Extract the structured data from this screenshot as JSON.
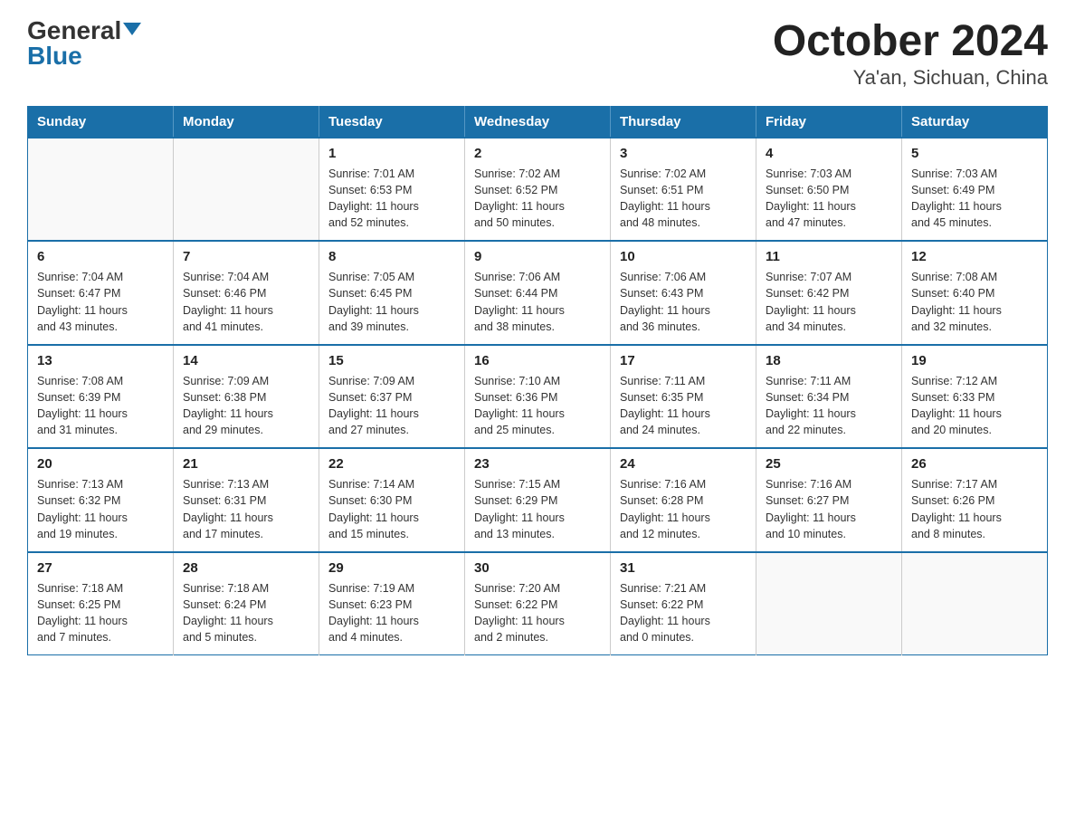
{
  "logo": {
    "general": "General",
    "blue": "Blue"
  },
  "title": "October 2024",
  "subtitle": "Ya'an, Sichuan, China",
  "days_of_week": [
    "Sunday",
    "Monday",
    "Tuesday",
    "Wednesday",
    "Thursday",
    "Friday",
    "Saturday"
  ],
  "weeks": [
    [
      {
        "day": "",
        "info": ""
      },
      {
        "day": "",
        "info": ""
      },
      {
        "day": "1",
        "info": "Sunrise: 7:01 AM\nSunset: 6:53 PM\nDaylight: 11 hours\nand 52 minutes."
      },
      {
        "day": "2",
        "info": "Sunrise: 7:02 AM\nSunset: 6:52 PM\nDaylight: 11 hours\nand 50 minutes."
      },
      {
        "day": "3",
        "info": "Sunrise: 7:02 AM\nSunset: 6:51 PM\nDaylight: 11 hours\nand 48 minutes."
      },
      {
        "day": "4",
        "info": "Sunrise: 7:03 AM\nSunset: 6:50 PM\nDaylight: 11 hours\nand 47 minutes."
      },
      {
        "day": "5",
        "info": "Sunrise: 7:03 AM\nSunset: 6:49 PM\nDaylight: 11 hours\nand 45 minutes."
      }
    ],
    [
      {
        "day": "6",
        "info": "Sunrise: 7:04 AM\nSunset: 6:47 PM\nDaylight: 11 hours\nand 43 minutes."
      },
      {
        "day": "7",
        "info": "Sunrise: 7:04 AM\nSunset: 6:46 PM\nDaylight: 11 hours\nand 41 minutes."
      },
      {
        "day": "8",
        "info": "Sunrise: 7:05 AM\nSunset: 6:45 PM\nDaylight: 11 hours\nand 39 minutes."
      },
      {
        "day": "9",
        "info": "Sunrise: 7:06 AM\nSunset: 6:44 PM\nDaylight: 11 hours\nand 38 minutes."
      },
      {
        "day": "10",
        "info": "Sunrise: 7:06 AM\nSunset: 6:43 PM\nDaylight: 11 hours\nand 36 minutes."
      },
      {
        "day": "11",
        "info": "Sunrise: 7:07 AM\nSunset: 6:42 PM\nDaylight: 11 hours\nand 34 minutes."
      },
      {
        "day": "12",
        "info": "Sunrise: 7:08 AM\nSunset: 6:40 PM\nDaylight: 11 hours\nand 32 minutes."
      }
    ],
    [
      {
        "day": "13",
        "info": "Sunrise: 7:08 AM\nSunset: 6:39 PM\nDaylight: 11 hours\nand 31 minutes."
      },
      {
        "day": "14",
        "info": "Sunrise: 7:09 AM\nSunset: 6:38 PM\nDaylight: 11 hours\nand 29 minutes."
      },
      {
        "day": "15",
        "info": "Sunrise: 7:09 AM\nSunset: 6:37 PM\nDaylight: 11 hours\nand 27 minutes."
      },
      {
        "day": "16",
        "info": "Sunrise: 7:10 AM\nSunset: 6:36 PM\nDaylight: 11 hours\nand 25 minutes."
      },
      {
        "day": "17",
        "info": "Sunrise: 7:11 AM\nSunset: 6:35 PM\nDaylight: 11 hours\nand 24 minutes."
      },
      {
        "day": "18",
        "info": "Sunrise: 7:11 AM\nSunset: 6:34 PM\nDaylight: 11 hours\nand 22 minutes."
      },
      {
        "day": "19",
        "info": "Sunrise: 7:12 AM\nSunset: 6:33 PM\nDaylight: 11 hours\nand 20 minutes."
      }
    ],
    [
      {
        "day": "20",
        "info": "Sunrise: 7:13 AM\nSunset: 6:32 PM\nDaylight: 11 hours\nand 19 minutes."
      },
      {
        "day": "21",
        "info": "Sunrise: 7:13 AM\nSunset: 6:31 PM\nDaylight: 11 hours\nand 17 minutes."
      },
      {
        "day": "22",
        "info": "Sunrise: 7:14 AM\nSunset: 6:30 PM\nDaylight: 11 hours\nand 15 minutes."
      },
      {
        "day": "23",
        "info": "Sunrise: 7:15 AM\nSunset: 6:29 PM\nDaylight: 11 hours\nand 13 minutes."
      },
      {
        "day": "24",
        "info": "Sunrise: 7:16 AM\nSunset: 6:28 PM\nDaylight: 11 hours\nand 12 minutes."
      },
      {
        "day": "25",
        "info": "Sunrise: 7:16 AM\nSunset: 6:27 PM\nDaylight: 11 hours\nand 10 minutes."
      },
      {
        "day": "26",
        "info": "Sunrise: 7:17 AM\nSunset: 6:26 PM\nDaylight: 11 hours\nand 8 minutes."
      }
    ],
    [
      {
        "day": "27",
        "info": "Sunrise: 7:18 AM\nSunset: 6:25 PM\nDaylight: 11 hours\nand 7 minutes."
      },
      {
        "day": "28",
        "info": "Sunrise: 7:18 AM\nSunset: 6:24 PM\nDaylight: 11 hours\nand 5 minutes."
      },
      {
        "day": "29",
        "info": "Sunrise: 7:19 AM\nSunset: 6:23 PM\nDaylight: 11 hours\nand 4 minutes."
      },
      {
        "day": "30",
        "info": "Sunrise: 7:20 AM\nSunset: 6:22 PM\nDaylight: 11 hours\nand 2 minutes."
      },
      {
        "day": "31",
        "info": "Sunrise: 7:21 AM\nSunset: 6:22 PM\nDaylight: 11 hours\nand 0 minutes."
      },
      {
        "day": "",
        "info": ""
      },
      {
        "day": "",
        "info": ""
      }
    ]
  ]
}
